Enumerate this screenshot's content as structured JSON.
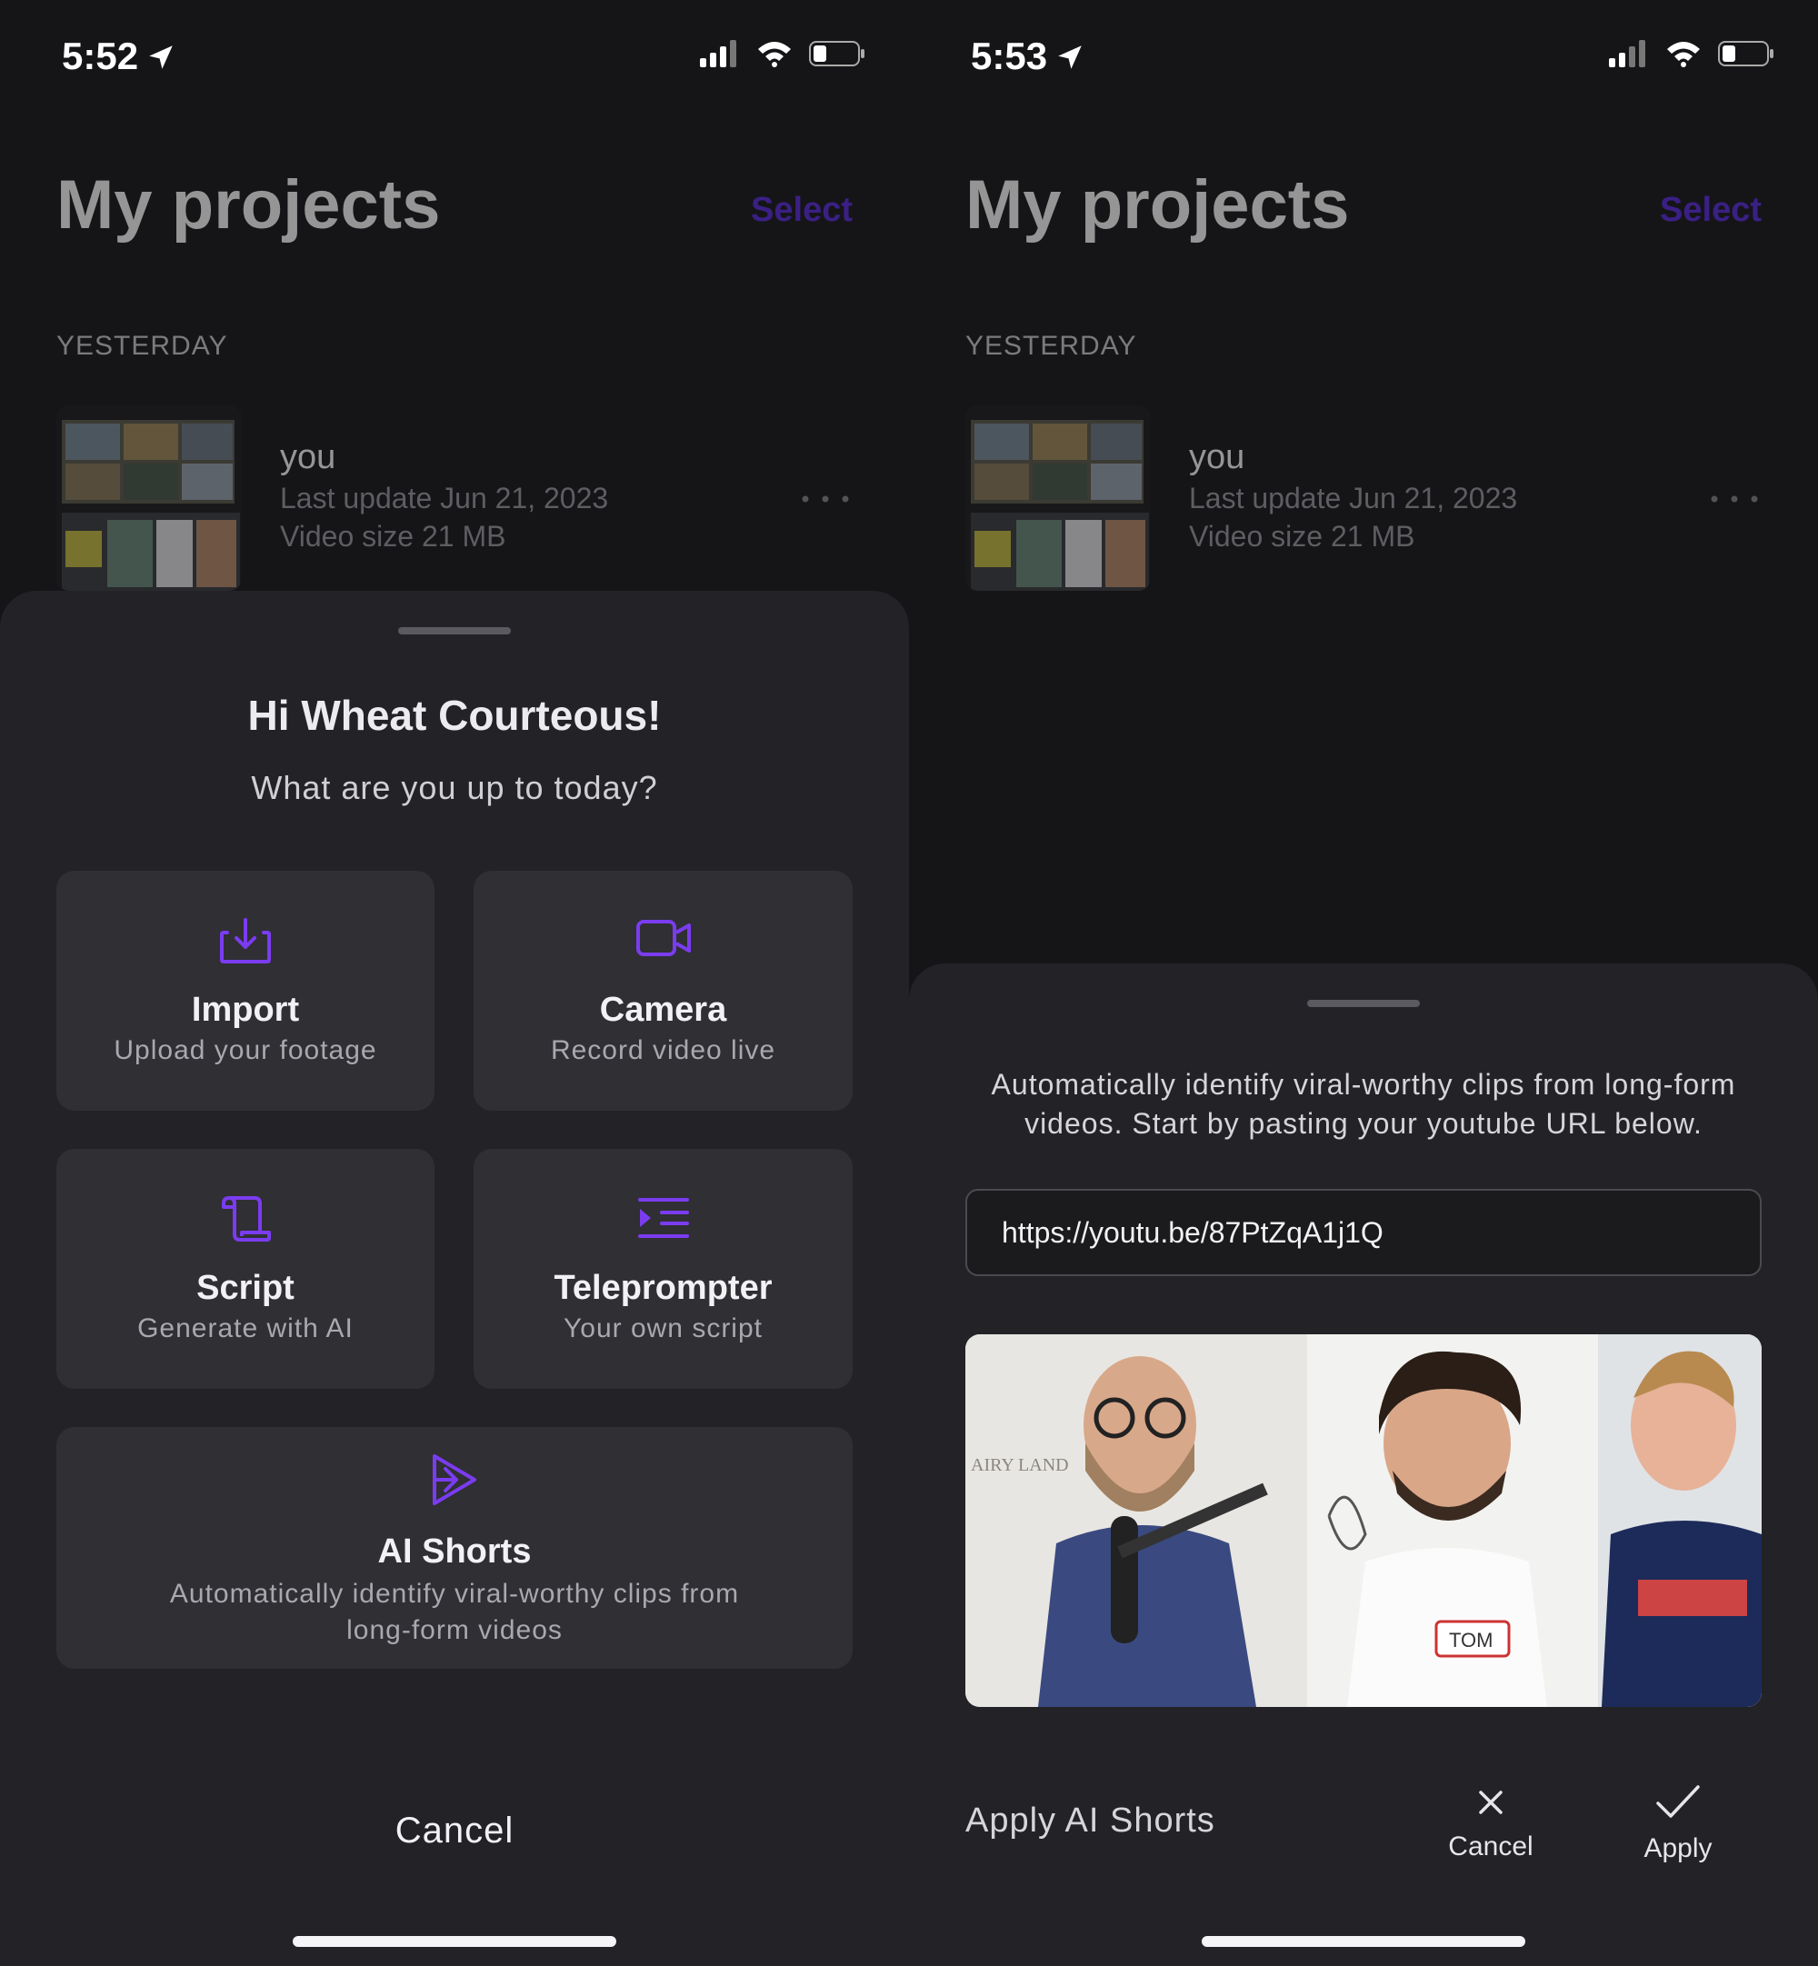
{
  "left": {
    "status": {
      "time": "5:52"
    },
    "header": {
      "title": "My projects",
      "select": "Select"
    },
    "section": "YESTERDAY",
    "project": {
      "name": "you",
      "last_update": "Last update Jun 21, 2023",
      "video_size": "Video size 21 MB"
    },
    "sheet": {
      "greeting": "Hi Wheat Courteous!",
      "subtitle": "What are you up to today?",
      "cards": [
        {
          "title": "Import",
          "subtitle": "Upload your footage",
          "icon": "download-icon"
        },
        {
          "title": "Camera",
          "subtitle": "Record video live",
          "icon": "video-camera-icon"
        },
        {
          "title": "Script",
          "subtitle": "Generate with AI",
          "icon": "scroll-icon"
        },
        {
          "title": "Teleprompter",
          "subtitle": "Your own script",
          "icon": "teleprompter-icon"
        },
        {
          "title": "AI Shorts",
          "subtitle_line1": "Automatically identify viral-worthy clips from",
          "subtitle_line2": "long-form videos",
          "icon": "ai-shorts-icon"
        }
      ],
      "cancel": "Cancel"
    }
  },
  "right": {
    "status": {
      "time": "5:53"
    },
    "header": {
      "title": "My projects",
      "select": "Select"
    },
    "section": "YESTERDAY",
    "project": {
      "name": "you",
      "last_update": "Last update Jun 21, 2023",
      "video_size": "Video size 21 MB"
    },
    "sheet": {
      "description_line1": "Automatically identify viral-worthy clips from long-form",
      "description_line2": "videos. Start by pasting your youtube URL below.",
      "url_value": "https://youtu.be/87PtZqA1j1Q",
      "preview_texts": {
        "name_tag": "TOM",
        "sign": "AIRY LAND"
      },
      "footer_title": "Apply AI Shorts",
      "cancel": "Cancel",
      "apply": "Apply"
    }
  },
  "colors": {
    "accent": "#7b3cf0",
    "select": "#5a2be0",
    "sheet_bg": "#232327",
    "card_bg": "#2f2f34"
  }
}
